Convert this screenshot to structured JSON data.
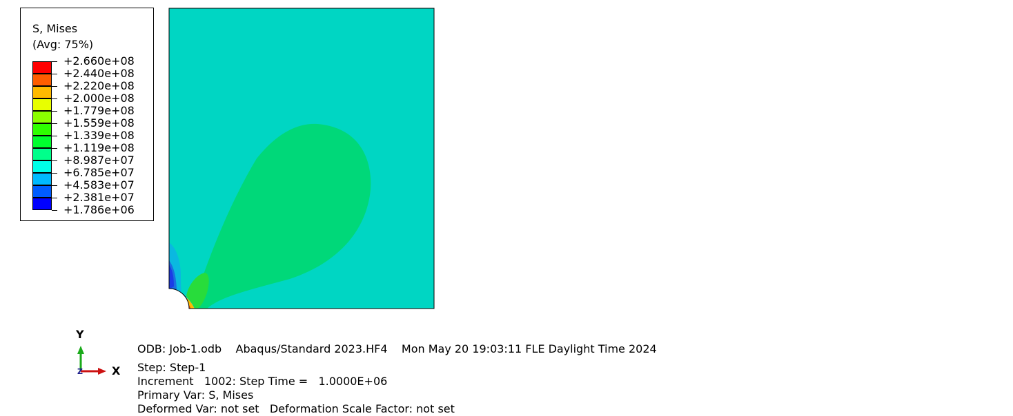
{
  "legend": {
    "title_line1": "S, Mises",
    "title_line2": "(Avg: 75%)",
    "values": [
      "+2.660e+08",
      "+2.440e+08",
      "+2.220e+08",
      "+2.000e+08",
      "+1.779e+08",
      "+1.559e+08",
      "+1.339e+08",
      "+1.119e+08",
      "+8.987e+07",
      "+6.785e+07",
      "+4.583e+07",
      "+2.381e+07",
      "+1.786e+06"
    ],
    "colors": [
      "#ff0000",
      "#ff5d00",
      "#ffba00",
      "#e8ff00",
      "#8bff00",
      "#2eff00",
      "#00ff2e",
      "#00ff8b",
      "#00ffe8",
      "#00baff",
      "#005dff",
      "#0000ff"
    ]
  },
  "contour_colors": {
    "background": "#00d6c3",
    "lobe": "#00d879",
    "inner": "#28dc3b",
    "low1": "#0ab8e0",
    "low2": "#1a6ee0",
    "low3": "#1b3ce6",
    "hot1": "#ffba00",
    "hot2": "#ff5d00"
  },
  "triad": {
    "y_label": "Y",
    "x_label": "X",
    "z_label": "Z"
  },
  "info": {
    "odb_line": "ODB: Job-1.odb    Abaqus/Standard 2023.HF4    Mon May 20 19:03:11 FLE Daylight Time 2024",
    "step_line": "Step: Step-1",
    "increment_line": "Increment   1002: Step Time =   1.0000E+06",
    "primary_line": "Primary Var: S, Mises",
    "deformed_line": "Deformed Var: not set   Deformation Scale Factor: not set"
  }
}
